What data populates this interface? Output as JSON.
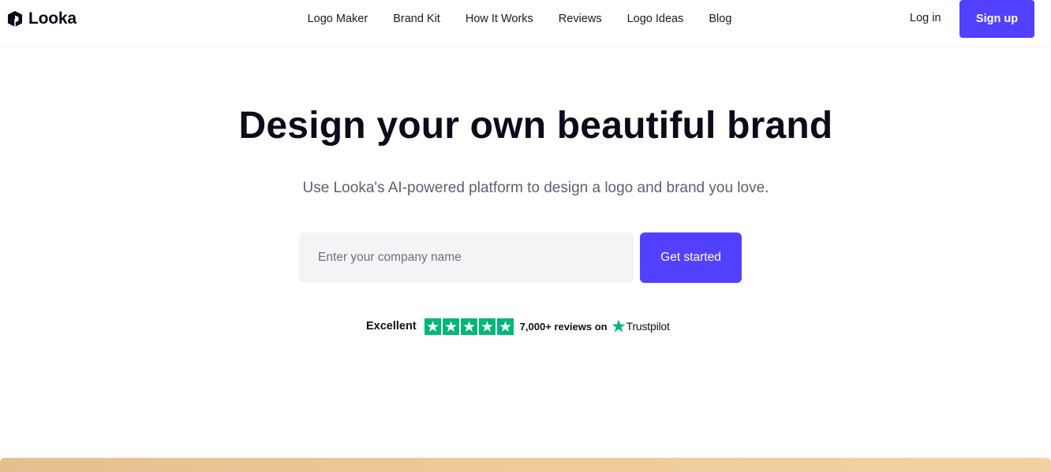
{
  "header": {
    "brand": "Looka",
    "nav": [
      {
        "label": "Logo Maker"
      },
      {
        "label": "Brand Kit"
      },
      {
        "label": "How It Works"
      },
      {
        "label": "Reviews"
      },
      {
        "label": "Logo Ideas"
      },
      {
        "label": "Blog"
      }
    ],
    "login_label": "Log in",
    "signup_label": "Sign up"
  },
  "hero": {
    "title": "Design your own beautiful brand",
    "subtitle": "Use Looka's AI-powered platform to design a logo and brand you love."
  },
  "form": {
    "company_value": "",
    "company_placeholder": "Enter your company name",
    "submit_label": "Get started"
  },
  "trust": {
    "rating_label": "Excellent",
    "stars": 5,
    "reviews_label": "7,000+ reviews on",
    "platform": "Trustpilot",
    "star_icon": "star-icon",
    "platform_icon": "trustpilot-star-icon"
  },
  "colors": {
    "accent": "#5340ff",
    "trustpilot_green": "#00b67a",
    "band": "#efcb99"
  }
}
